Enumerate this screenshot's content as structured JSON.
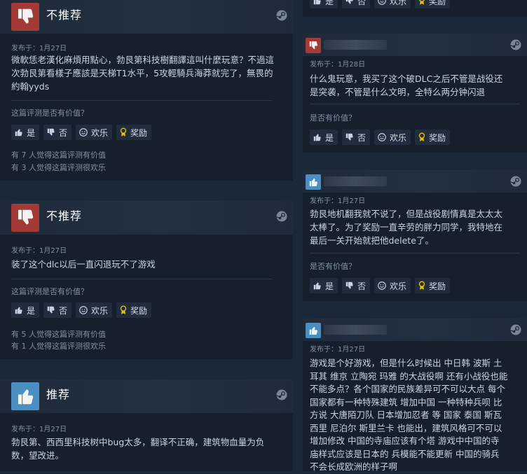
{
  "buttons": {
    "yes": "是",
    "no": "否",
    "funny": "欢乐",
    "award": "奖励"
  },
  "helpful_question": "这篇评测是否有价值？",
  "helpful_question_short": "是否有价值？",
  "reviews_left": [
    {
      "verdict": "不推荐",
      "recommended": false,
      "posted": "发布于：1月27日",
      "text_lines": [
        "微軟恁老漢化麻煩用點心，勃艮第科技樹翻譯這叫什麼玩意？不過這",
        "次勃艮第看樣子應該是天梯T1水平，5攻輕騎兵海莽就完了，無畏的",
        "約翰yyds"
      ],
      "stats": [
        "有 7 人觉得这篇评测有价值",
        "有 3 人觉得这篇评测很欢乐"
      ]
    },
    {
      "verdict": "不推荐",
      "recommended": false,
      "posted": "发布于：1月27日",
      "text_lines": [
        "装了这个dlc以后一直闪退玩不了游戏"
      ],
      "stats": [
        "有 5 人觉得这篇评测有价值",
        "有 1 人觉得这篇评测很欢乐"
      ]
    },
    {
      "verdict": "推荐",
      "recommended": true,
      "posted": "发布于：1月27日",
      "text_lines": [
        "勃艮第、西西里科技树中bug太多，翻译不正确，建筑物血量为负",
        "数，望改进。"
      ]
    }
  ],
  "reviews_right": [
    {
      "recommended": false,
      "posted": "发布于：1月28日",
      "text_lines": [
        "什么鬼玩意，我买了这个破DLC之后不管是战役还",
        "是突袭，不管是什么文明，全特么两分钟闪退"
      ]
    },
    {
      "recommended": true,
      "posted": "发布于：1月27日",
      "text_lines": [
        "勃艮地机翻我就不说了，但是战役剧情真是太太太",
        "太棒了。为了奖励一直辛劳的胖力同学，我特地在",
        "最后一关开始就把他delete了。"
      ]
    },
    {
      "recommended": true,
      "posted": "发布于：1月27日",
      "text_lines": [
        "游戏是个好游戏，但是什么时候出 中日韩 波斯 土",
        "耳其 维京 立陶宛 玛雅 的大战役啊 还有小战役也能",
        "不能多点？各个国家的民族差异可不可以大点 每个",
        "国家都有一种特殊建筑 增加中国 一种特种兵呗 比",
        "方说 大唐陌刀队 日本增加忍者 等 国家 泰国 斯瓦",
        "西里 尼泊尔 斯里兰卡 也能出，建筑风格可不可以",
        "增加修改 中国的寺庙应该有个塔 游戏中中国的寺",
        "庙样式应该是日本的 兵模能不能更新 中国的骑兵",
        "不会长成欧洲的样子啊"
      ]
    }
  ],
  "icons": [
    "thumbs-down-icon",
    "thumbs-up-icon",
    "steam-icon",
    "smiley-icon",
    "award-icon"
  ]
}
